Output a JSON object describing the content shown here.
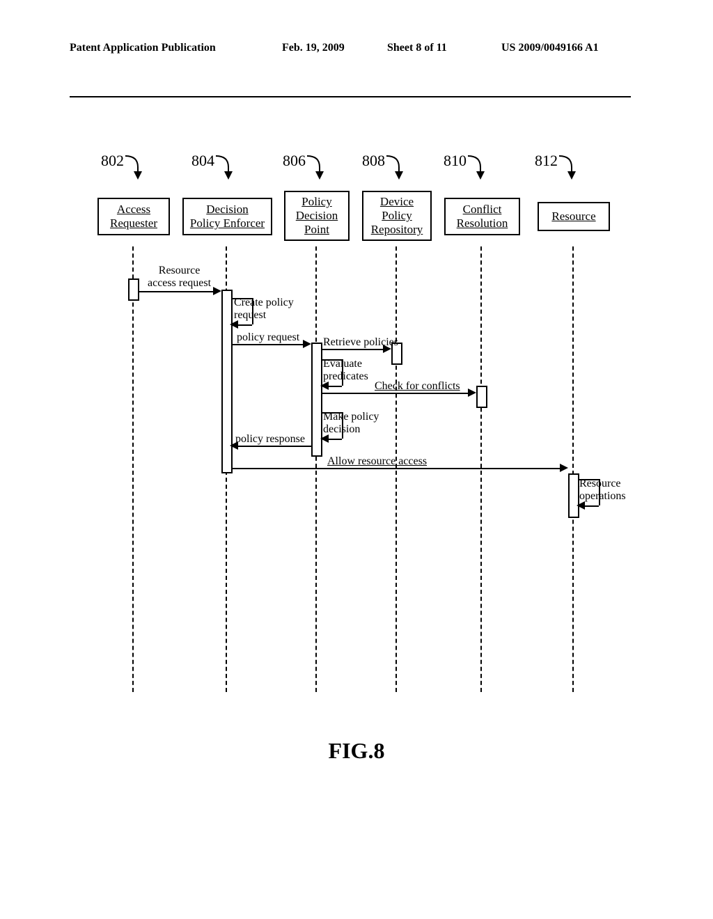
{
  "header": {
    "left": "Patent Application Publication",
    "date": "Feb. 19, 2009",
    "sheet": "Sheet 8 of 11",
    "pubno": "US 2009/0049166 A1"
  },
  "refs": {
    "r802": "802",
    "r804": "804",
    "r806": "806",
    "r808": "808",
    "r810": "810",
    "r812": "812"
  },
  "actors": {
    "a1l1": "Access",
    "a1l2": "Requester",
    "a2l1": "Decision",
    "a2l2": "Policy Enforcer",
    "a3l1": "Policy",
    "a3l2": "Decision",
    "a3l3": "Point",
    "a4l1": "Device",
    "a4l2": "Policy",
    "a4l3": "Repository",
    "a5l1": "Conflict",
    "a5l2": "Resolution",
    "a6l1": "Resource"
  },
  "messages": {
    "m1l1": "Resource",
    "m1l2": "access request",
    "m2l1": "Create policy",
    "m2l2": "request",
    "m3": "policy request",
    "m4": "Retrieve policies",
    "m5l1": "Evaluate",
    "m5l2": "predicates",
    "m6": "Check for conflicts",
    "m7l1": "Make policy",
    "m7l2": "decision",
    "m8": "policy response",
    "m9": "Allow resource access",
    "m10l1": "Resource",
    "m10l2": "operations"
  },
  "figure_caption": "FIG.8"
}
